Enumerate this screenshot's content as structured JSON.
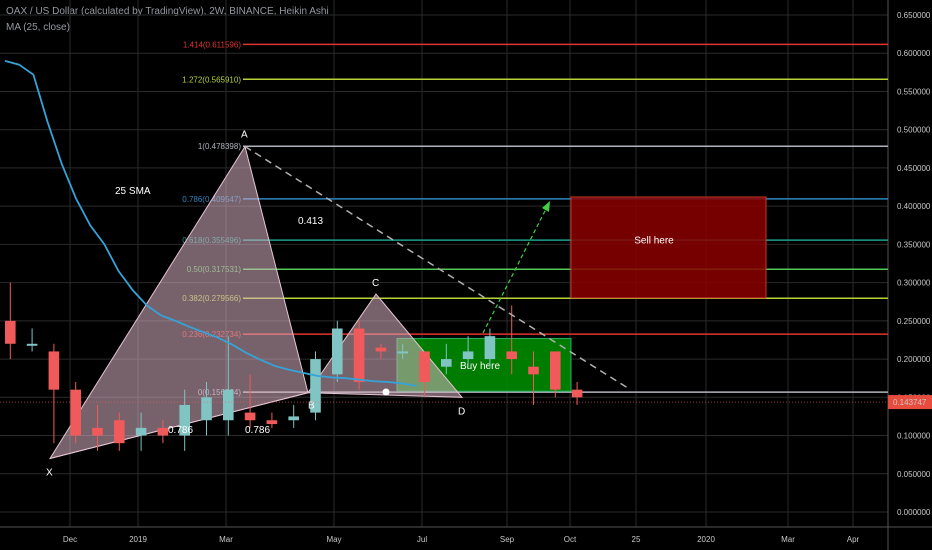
{
  "header": {
    "line1": "OAX / US Dollar (calculated by TradingView), 2W, BINANCE, Heikin Ashi",
    "line2": "MA (25, close)"
  },
  "chart_data": {
    "type": "candlestick",
    "x_ticks": [
      "Dec",
      "2019",
      "Mar",
      "May",
      "Jul",
      "Sep",
      "Oct",
      "25",
      "2020",
      "Mar",
      "Apr"
    ],
    "y_ticks": [
      "0.650000",
      "0.600000",
      "0.550000",
      "0.500000",
      "0.450000",
      "0.400000",
      "0.350000",
      "0.300000",
      "0.250000",
      "0.200000",
      "0.150000",
      "0.100000",
      "0.050000",
      "0.000000"
    ],
    "ylim": [
      -0.01,
      0.655
    ],
    "current_price": "0.143747",
    "candles": [
      {
        "o": 0.25,
        "c": 0.22,
        "h": 0.3,
        "l": 0.2
      },
      {
        "o": 0.22,
        "c": 0.22,
        "h": 0.24,
        "l": 0.21
      },
      {
        "o": 0.21,
        "c": 0.16,
        "h": 0.22,
        "l": 0.09
      },
      {
        "o": 0.16,
        "c": 0.1,
        "h": 0.17,
        "l": 0.09
      },
      {
        "o": 0.11,
        "c": 0.1,
        "h": 0.14,
        "l": 0.08
      },
      {
        "o": 0.12,
        "c": 0.09,
        "h": 0.13,
        "l": 0.08
      },
      {
        "o": 0.1,
        "c": 0.11,
        "h": 0.13,
        "l": 0.08
      },
      {
        "o": 0.11,
        "c": 0.1,
        "h": 0.12,
        "l": 0.09
      },
      {
        "o": 0.1,
        "c": 0.14,
        "h": 0.16,
        "l": 0.08
      },
      {
        "o": 0.12,
        "c": 0.15,
        "h": 0.17,
        "l": 0.1
      },
      {
        "o": 0.12,
        "c": 0.16,
        "h": 0.23,
        "l": 0.1
      },
      {
        "o": 0.13,
        "c": 0.12,
        "h": 0.18,
        "l": 0.11
      },
      {
        "o": 0.12,
        "c": 0.115,
        "h": 0.13,
        "l": 0.11
      },
      {
        "o": 0.12,
        "c": 0.125,
        "h": 0.14,
        "l": 0.11
      },
      {
        "o": 0.13,
        "c": 0.2,
        "h": 0.21,
        "l": 0.12
      },
      {
        "o": 0.18,
        "c": 0.24,
        "h": 0.25,
        "l": 0.17
      },
      {
        "o": 0.24,
        "c": 0.17,
        "h": 0.25,
        "l": 0.16
      },
      {
        "o": 0.215,
        "c": 0.21,
        "h": 0.22,
        "l": 0.2
      },
      {
        "o": 0.21,
        "c": 0.21,
        "h": 0.22,
        "l": 0.2
      },
      {
        "o": 0.21,
        "c": 0.17,
        "h": 0.21,
        "l": 0.15
      },
      {
        "o": 0.19,
        "c": 0.2,
        "h": 0.22,
        "l": 0.18
      },
      {
        "o": 0.2,
        "c": 0.21,
        "h": 0.23,
        "l": 0.19
      },
      {
        "o": 0.2,
        "c": 0.23,
        "h": 0.24,
        "l": 0.19
      },
      {
        "o": 0.21,
        "c": 0.2,
        "h": 0.27,
        "l": 0.18
      },
      {
        "o": 0.19,
        "c": 0.18,
        "h": 0.21,
        "l": 0.14
      },
      {
        "o": 0.21,
        "c": 0.16,
        "h": 0.21,
        "l": 0.15
      },
      {
        "o": 0.16,
        "c": 0.15,
        "h": 0.17,
        "l": 0.14
      }
    ],
    "sma": {
      "label": "25 SMA",
      "values": [
        0.59,
        0.585,
        0.572,
        0.51,
        0.455,
        0.41,
        0.375,
        0.35,
        0.315,
        0.29,
        0.27,
        0.257,
        0.25,
        0.242,
        0.235,
        0.228,
        0.219,
        0.208,
        0.199,
        0.191,
        0.186,
        0.182,
        0.178,
        0.176,
        0.175,
        0.173,
        0.171,
        0.17,
        0.168,
        0.165
      ]
    },
    "fib_levels": [
      {
        "label": "1.414(0.611596)",
        "value": 0.6116,
        "color": "#e0342e"
      },
      {
        "label": "1.272(0.565910)",
        "value": 0.5659,
        "color": "#b7d336"
      },
      {
        "label": "1(0.478398)",
        "value": 0.4784,
        "color": "#b2b5be"
      },
      {
        "label": "0.786(0.409547)",
        "value": 0.4095,
        "color": "#2e86c1"
      },
      {
        "label": "0.618(0.355496)",
        "value": 0.3555,
        "color": "#1e9e8c"
      },
      {
        "label": "0.50(0.317531)",
        "value": 0.3175,
        "color": "#55c957"
      },
      {
        "label": "0.382(0.279566)",
        "value": 0.2796,
        "color": "#b7d336"
      },
      {
        "label": "0.236(0.232734)",
        "value": 0.2327,
        "color": "#e0342e"
      },
      {
        "label": "0(0.156664)",
        "value": 0.1567,
        "color": "#b2b5be"
      }
    ],
    "pattern_points": {
      "X": {
        "label": "X",
        "price": 0.07
      },
      "A": {
        "label": "A",
        "price": 0.478
      },
      "B": {
        "label": "B",
        "price": 0.156
      },
      "C": {
        "label": "C",
        "price": 0.285
      },
      "D": {
        "label": "D",
        "price": 0.15
      }
    },
    "ratios": [
      "0.786",
      "0.786",
      "0.413"
    ],
    "boxes": {
      "sell": {
        "label": "Sell here",
        "top": 0.412,
        "bottom": 0.28,
        "color": "#8b0000"
      },
      "buy": {
        "label": "Buy here",
        "top": 0.227,
        "bottom": 0.158,
        "color": "#008a00"
      }
    },
    "trend_line": {
      "from": 0.478,
      "to": 0.162
    }
  }
}
